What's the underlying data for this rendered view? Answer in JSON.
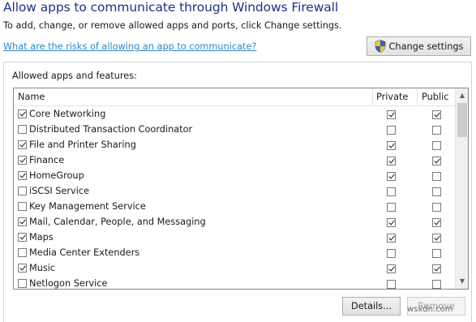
{
  "page": {
    "title": "Allow apps to communicate through Windows Firewall",
    "subtitle": "To add, change, or remove allowed apps and ports, click Change settings.",
    "risk_link": "What are the risks of allowing an app to communicate?",
    "change_settings_label": "Change settings"
  },
  "group": {
    "title": "Allowed apps and features:",
    "columns": {
      "name": "Name",
      "private": "Private",
      "public": "Public"
    },
    "items": [
      {
        "name": "Core Networking",
        "enabled": true,
        "private": true,
        "public": true
      },
      {
        "name": "Distributed Transaction Coordinator",
        "enabled": false,
        "private": false,
        "public": false
      },
      {
        "name": "File and Printer Sharing",
        "enabled": true,
        "private": true,
        "public": false
      },
      {
        "name": "Finance",
        "enabled": true,
        "private": true,
        "public": true
      },
      {
        "name": "HomeGroup",
        "enabled": true,
        "private": true,
        "public": false
      },
      {
        "name": "iSCSI Service",
        "enabled": false,
        "private": false,
        "public": false
      },
      {
        "name": "Key Management Service",
        "enabled": false,
        "private": false,
        "public": false
      },
      {
        "name": "Mail, Calendar, People, and Messaging",
        "enabled": true,
        "private": true,
        "public": true
      },
      {
        "name": "Maps",
        "enabled": true,
        "private": true,
        "public": true
      },
      {
        "name": "Media Center Extenders",
        "enabled": false,
        "private": false,
        "public": false
      },
      {
        "name": "Music",
        "enabled": true,
        "private": true,
        "public": true
      },
      {
        "name": "Netlogon Service",
        "enabled": false,
        "private": false,
        "public": false
      }
    ]
  },
  "buttons": {
    "details_label": "Details...",
    "remove_label": "Remove"
  },
  "watermark": "wsxdn.com",
  "colors": {
    "title": "#1e3287",
    "link": "#2a86c7",
    "shield_blue": "#2f64c2",
    "shield_yellow": "#f2c12e"
  }
}
